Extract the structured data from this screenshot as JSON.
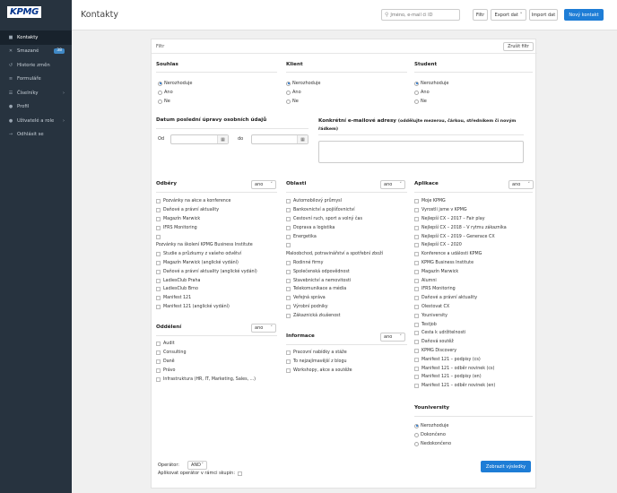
{
  "sidebar": {
    "logo": "KPMG",
    "items": [
      {
        "label": "Kontakty",
        "icon": "contact-book-icon"
      },
      {
        "label": "Smazané",
        "badge": "38",
        "icon": "trash-icon"
      },
      {
        "label": "Historie změn",
        "icon": "history-icon"
      },
      {
        "label": "Formuláře",
        "icon": "form-icon"
      },
      {
        "label": "Číselníky",
        "icon": "list-icon"
      },
      {
        "label": "Profil",
        "icon": "user-icon"
      },
      {
        "label": "Uživatelé a role",
        "icon": "users-icon"
      },
      {
        "label": "Odhlásit se",
        "icon": "logout-icon"
      }
    ]
  },
  "header": {
    "title": "Kontakty",
    "search_placeholder": "Jméno, e-mail či ID",
    "filter_label": "Filtr",
    "export_label": "Export dat",
    "import_label": "Import dat",
    "new_contact_label": "Nový kontakt"
  },
  "panel": {
    "title": "Filtr",
    "clear_label": "Zrušit filtr",
    "consent": {
      "title": "Souhlas",
      "options": [
        "Nerozhoduje",
        "Ano",
        "Ne"
      ],
      "selected": 0
    },
    "client": {
      "title": "Klient",
      "options": [
        "Nerozhoduje",
        "Ano",
        "Ne"
      ],
      "selected": 0
    },
    "student": {
      "title": "Student",
      "options": [
        "Nerozhoduje",
        "Ano",
        "Ne"
      ],
      "selected": 0
    },
    "date_title": "Datum poslední úpravy osobních údajů",
    "date_from": "Od",
    "date_to": "do",
    "email_title": "Konkrétní e-mailové adresy",
    "email_hint": "(oddělujte mezerou, čárkou, středníkem či novým řádkem)",
    "subscriptions": {
      "title": "Odběry",
      "select": "ano",
      "items": [
        {
          "label": "Pozvánky na akce a konference",
          "group": false
        },
        {
          "label": "Daňové a právní aktuality",
          "group": false
        },
        {
          "label": "Magazín Marwick",
          "group": false
        },
        {
          "label": "IFRS Monitoring",
          "group": false
        },
        {
          "label": "",
          "group": false
        },
        {
          "label": "Pozvánky na školení KPMG Business Institute",
          "group": true
        },
        {
          "label": "Studie a průzkumy z vašeho odvětví",
          "group": false
        },
        {
          "label": "Magazín Marwick (anglické vydání)",
          "group": false
        },
        {
          "label": "Daňové a právní aktuality (anglické vydání)",
          "group": false
        },
        {
          "label": "LadiesClub Praha",
          "group": false
        },
        {
          "label": "LadiesClub Brno",
          "group": false
        },
        {
          "label": "Manifest 121",
          "group": false
        },
        {
          "label": "Manifest 121 (anglické vydání)",
          "group": false
        }
      ]
    },
    "departments": {
      "title": "Oddělení",
      "select": "ano",
      "items": [
        "Audit",
        "Consulting",
        "Daně",
        "Právo",
        "Infrastruktura (HR, IT, Marketing, Sales, ...)"
      ]
    },
    "areas": {
      "title": "Oblasti",
      "select": "ano",
      "items": [
        {
          "label": "Automobilový průmysl",
          "group": false
        },
        {
          "label": "Bankovnictví a pojišťovnictví",
          "group": false
        },
        {
          "label": "Cestovní ruch, sport a volný čas",
          "group": false
        },
        {
          "label": "Doprava a logistika",
          "group": false
        },
        {
          "label": "Energetika",
          "group": false
        },
        {
          "label": "",
          "group": false
        },
        {
          "label": "Maloobchod, potravinářství a spotřební zboží",
          "group": true
        },
        {
          "label": "Rodinné firmy",
          "group": false
        },
        {
          "label": "Společenská odpovědnost",
          "group": false
        },
        {
          "label": "Stavebnictví a nemovitosti",
          "group": false
        },
        {
          "label": "Telekomunikace a média",
          "group": false
        },
        {
          "label": "Veřejná správa",
          "group": false
        },
        {
          "label": "Výrobní podniky",
          "group": false
        },
        {
          "label": "Zákaznická zkušenost",
          "group": false
        }
      ]
    },
    "information": {
      "title": "Informace",
      "select": "ano",
      "items": [
        "Pracovní nabídky a stáže",
        "To nejzajímavější z blogu",
        "Workshopy, akce a soutěže"
      ]
    },
    "applications": {
      "title": "Aplikace",
      "select": "ano",
      "items": [
        "Moje KPMG",
        "Vyrostli jsme v KPMG",
        "Nejlepší CX – 2017 – Fair play",
        "Nejlepší CX – 2018 – V rytmu zákazníka",
        "Nejlepší CX – 2019 – Generace CX",
        "Nejlepší CX – 2020",
        "Konference a události KPMG",
        "KPMG Business Institute",
        "Magazín Marwick",
        "Alumni",
        "IFRS Monitoring",
        "Daňové a právní aktuality",
        "Olestovat CX",
        "Youniversity",
        "Testjob",
        "Cesta k udržitelnosti",
        "Daňová soutěž",
        "KPMG Discovery",
        "Manifest 121 – podpisy (cs)",
        "Manifest 121 – odběr novinek (cs)",
        "Manifest 121 – podpisy (en)",
        "Manifest 121 – odběr novinek (en)"
      ]
    },
    "youniversity": {
      "title": "Youniversity",
      "options": [
        "Nerozhoduje",
        "Dokončeno",
        "Nedokončeno"
      ],
      "selected": 0
    },
    "operator_label": "Operátor:",
    "operator_value": "AND",
    "apply_operator_label": "Aplikovat operátor v rámci skupin:",
    "show_results_label": "Zobrazit výsledky"
  }
}
